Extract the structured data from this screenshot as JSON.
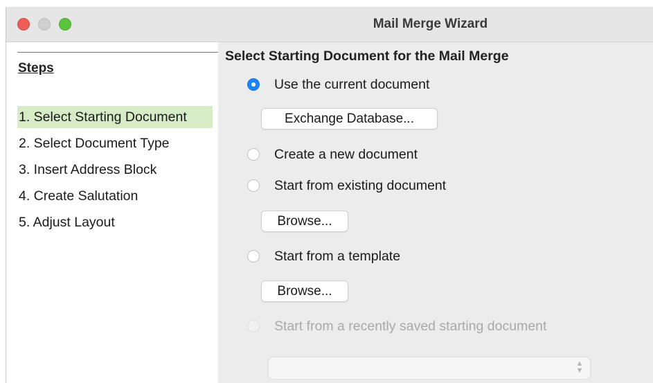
{
  "window": {
    "title": "Mail Merge Wizard"
  },
  "sidebar": {
    "heading": "Steps",
    "steps": [
      {
        "label": "1. Select Starting Document",
        "active": true
      },
      {
        "label": "2. Select Document Type",
        "active": false
      },
      {
        "label": "3. Insert Address Block",
        "active": false
      },
      {
        "label": "4. Create Salutation",
        "active": false
      },
      {
        "label": "5. Adjust Layout",
        "active": false
      }
    ]
  },
  "main": {
    "heading": "Select Starting Document for the Mail Merge",
    "options": [
      {
        "label": "Use the current document",
        "checked": true,
        "enabled": true
      },
      {
        "label": "Create a new document",
        "checked": false,
        "enabled": true
      },
      {
        "label": "Start from existing document",
        "checked": false,
        "enabled": true
      },
      {
        "label": "Start from a template",
        "checked": false,
        "enabled": true
      },
      {
        "label": "Start from a recently saved starting document",
        "checked": false,
        "enabled": false
      }
    ],
    "exchange_button": "Exchange Database...",
    "browse_existing_button": "Browse...",
    "browse_template_button": "Browse...",
    "recent_select_value": ""
  },
  "colors": {
    "accent": "#1a82fb",
    "active_step": "#d6ecc7",
    "close": "#ed5f56",
    "zoom": "#5cc43c"
  }
}
